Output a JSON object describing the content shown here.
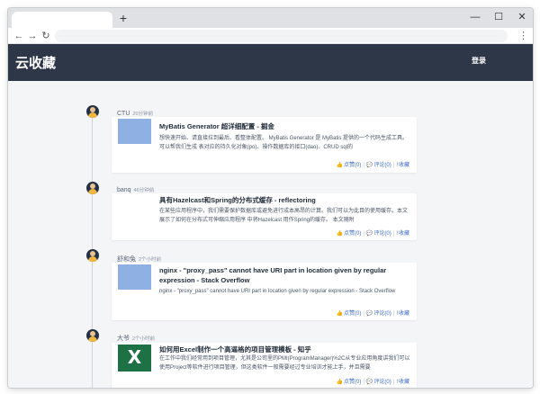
{
  "browser": {
    "new_tab": "+",
    "minimize": "—",
    "maximize": "☐",
    "close": "✕",
    "back": "←",
    "forward": "→",
    "reload": "↻",
    "menu": "⋮"
  },
  "header": {
    "logo": "云收藏",
    "login": "登录"
  },
  "items": [
    {
      "user": "CTU",
      "time": "20分钟前",
      "title": "MyBatis Generator 超详细配置 - 掘金",
      "summary": "想快速开始、请直接拉到最后、看整体配置。 MyBatis Generator 是 MyBatis 提供的一个代码生成工具。可以帮我们生成 表对应的持久化对象(po)、操作数据库的接口(dao)、CRUD sql的",
      "like": "点赞(0)",
      "comment": "评论(0)",
      "collect": "收藏",
      "thumb": "image"
    },
    {
      "user": "banq",
      "time": "46分钟前",
      "title": "具有Hazelcast和Spring的分布式缓存 - reflectoring",
      "summary": "在某些应用程序中，我们需要保护数据库或避免进行成本高昂的计算。我们可以为此目的使用缓存。本文展示了如何在分布式可伸缩应用程序 中将Hazelcast 用作Spring的缓存。 本文随附",
      "like": "点赞(0)",
      "comment": "评论(0)",
      "collect": "收藏",
      "thumb": "none"
    },
    {
      "user": "舒和兔",
      "time": "2个小时前",
      "title": "nginx - \"proxy_pass\" cannot have URI part in location given by regular expression - Stack Overflow",
      "summary": "nginx - \"proxy_pass\" cannot have URI part in location given by regular expression - Stack Overflow",
      "like": "点赞(0)",
      "comment": "评论(0)",
      "collect": "收藏",
      "thumb": "image"
    },
    {
      "user": "大爷",
      "time": "2个小时前",
      "title": "如何用Excel制作一个高逼格的项目管理模板 - 知乎",
      "summary": "在工作中我们经常用到项目管理，尤其是公司里的PMI(ProgramManager)%2C从专业应用角度讲我们可以使用Project等软件进行项目管理，但这类软件一般需要经过专业培训才能上手，并且需要",
      "like": "点赞(0)",
      "comment": "评论(0)",
      "collect": "收藏",
      "thumb": "excel",
      "thumb_letter": "X"
    }
  ],
  "icons": {
    "like": "👍",
    "comment": "💬",
    "collect": "!"
  },
  "colors": {
    "header_bg": "#2d3748",
    "page_bg": "#f4f5f7",
    "link": "#3b6ac4",
    "thumb": "#8fb0e3",
    "excel": "#1e7145"
  }
}
